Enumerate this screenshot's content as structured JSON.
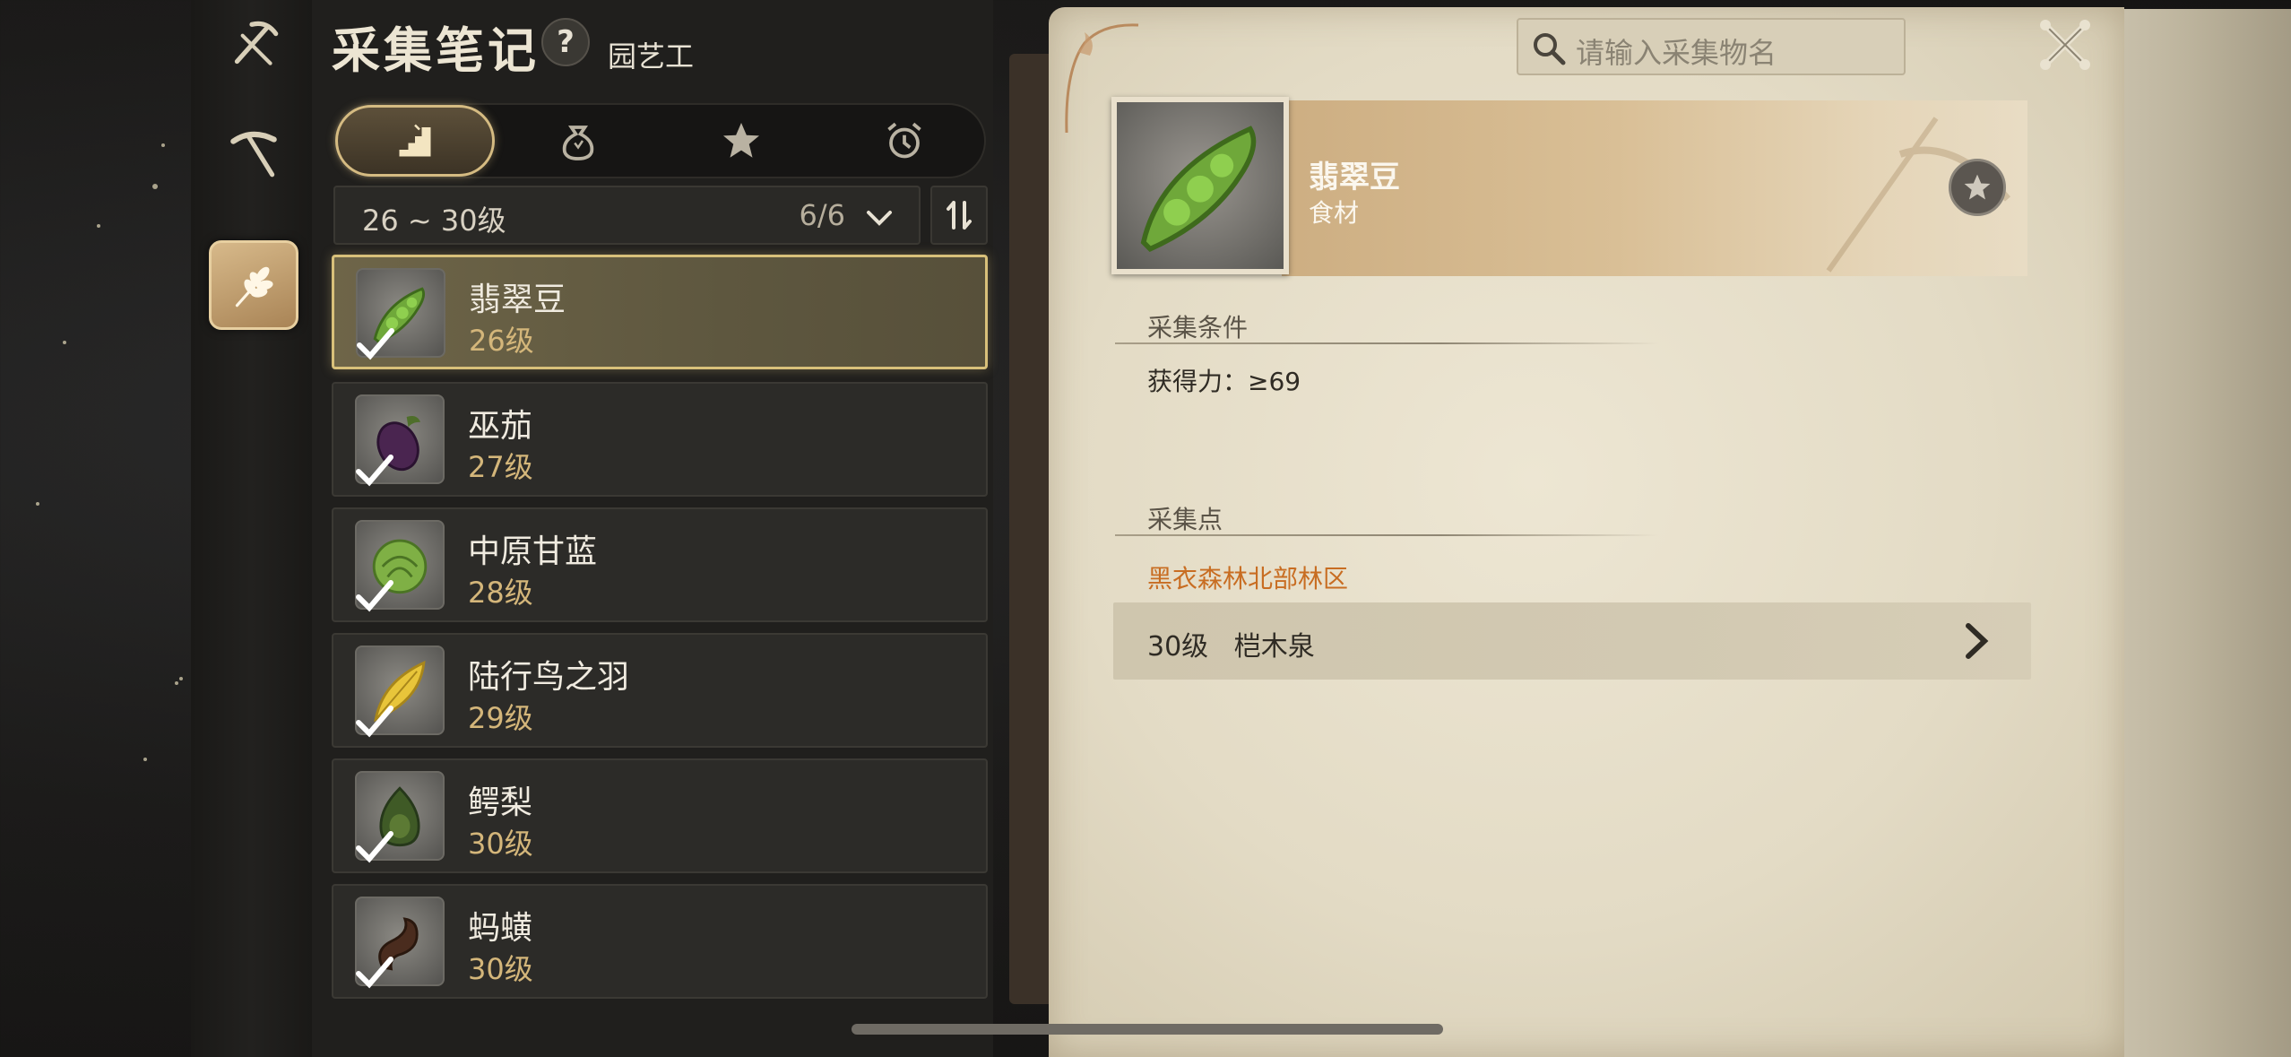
{
  "header": {
    "title": "采集笔记",
    "help_label": "?",
    "job": "园艺工"
  },
  "rail": {
    "items": [
      {
        "icon": "pickaxe-scythe-icon",
        "active": false
      },
      {
        "icon": "pickaxe-icon",
        "active": false
      },
      {
        "icon": "wheat-icon",
        "active": true
      }
    ]
  },
  "tabs": [
    {
      "icon": "level-stairs-icon",
      "active": true
    },
    {
      "icon": "money-bag-icon",
      "active": false
    },
    {
      "icon": "star-icon",
      "active": false
    },
    {
      "icon": "alarm-clock-icon",
      "active": false
    }
  ],
  "filter": {
    "range": "26 ~ 30级",
    "count": "6/6"
  },
  "items": [
    {
      "name": "翡翠豆",
      "level": "26级",
      "icon": "pea-pod-icon",
      "checked": true,
      "selected": true
    },
    {
      "name": "巫茄",
      "level": "27级",
      "icon": "eggplant-icon",
      "checked": true,
      "selected": false
    },
    {
      "name": "中原甘蓝",
      "level": "28级",
      "icon": "cabbage-icon",
      "checked": true,
      "selected": false
    },
    {
      "name": "陆行鸟之羽",
      "level": "29级",
      "icon": "feather-icon",
      "checked": true,
      "selected": false
    },
    {
      "name": "鳄梨",
      "level": "30级",
      "icon": "avocado-icon",
      "checked": true,
      "selected": false
    },
    {
      "name": "蚂蟥",
      "level": "30级",
      "icon": "leech-icon",
      "checked": true,
      "selected": false
    }
  ],
  "search": {
    "placeholder": "请输入采集物名"
  },
  "detail": {
    "name": "翡翠豆",
    "category": "食材",
    "conditions_heading": "采集条件",
    "condition": "获得力：≥69",
    "points_heading": "采集点",
    "region": "黑衣森林北部林区",
    "route": "30级   桤木泉"
  },
  "colors": {
    "accent_gold": "#d8c07a",
    "level_text": "#d4b67a",
    "region_text": "#c86d22",
    "paper": "#e6dec8"
  }
}
